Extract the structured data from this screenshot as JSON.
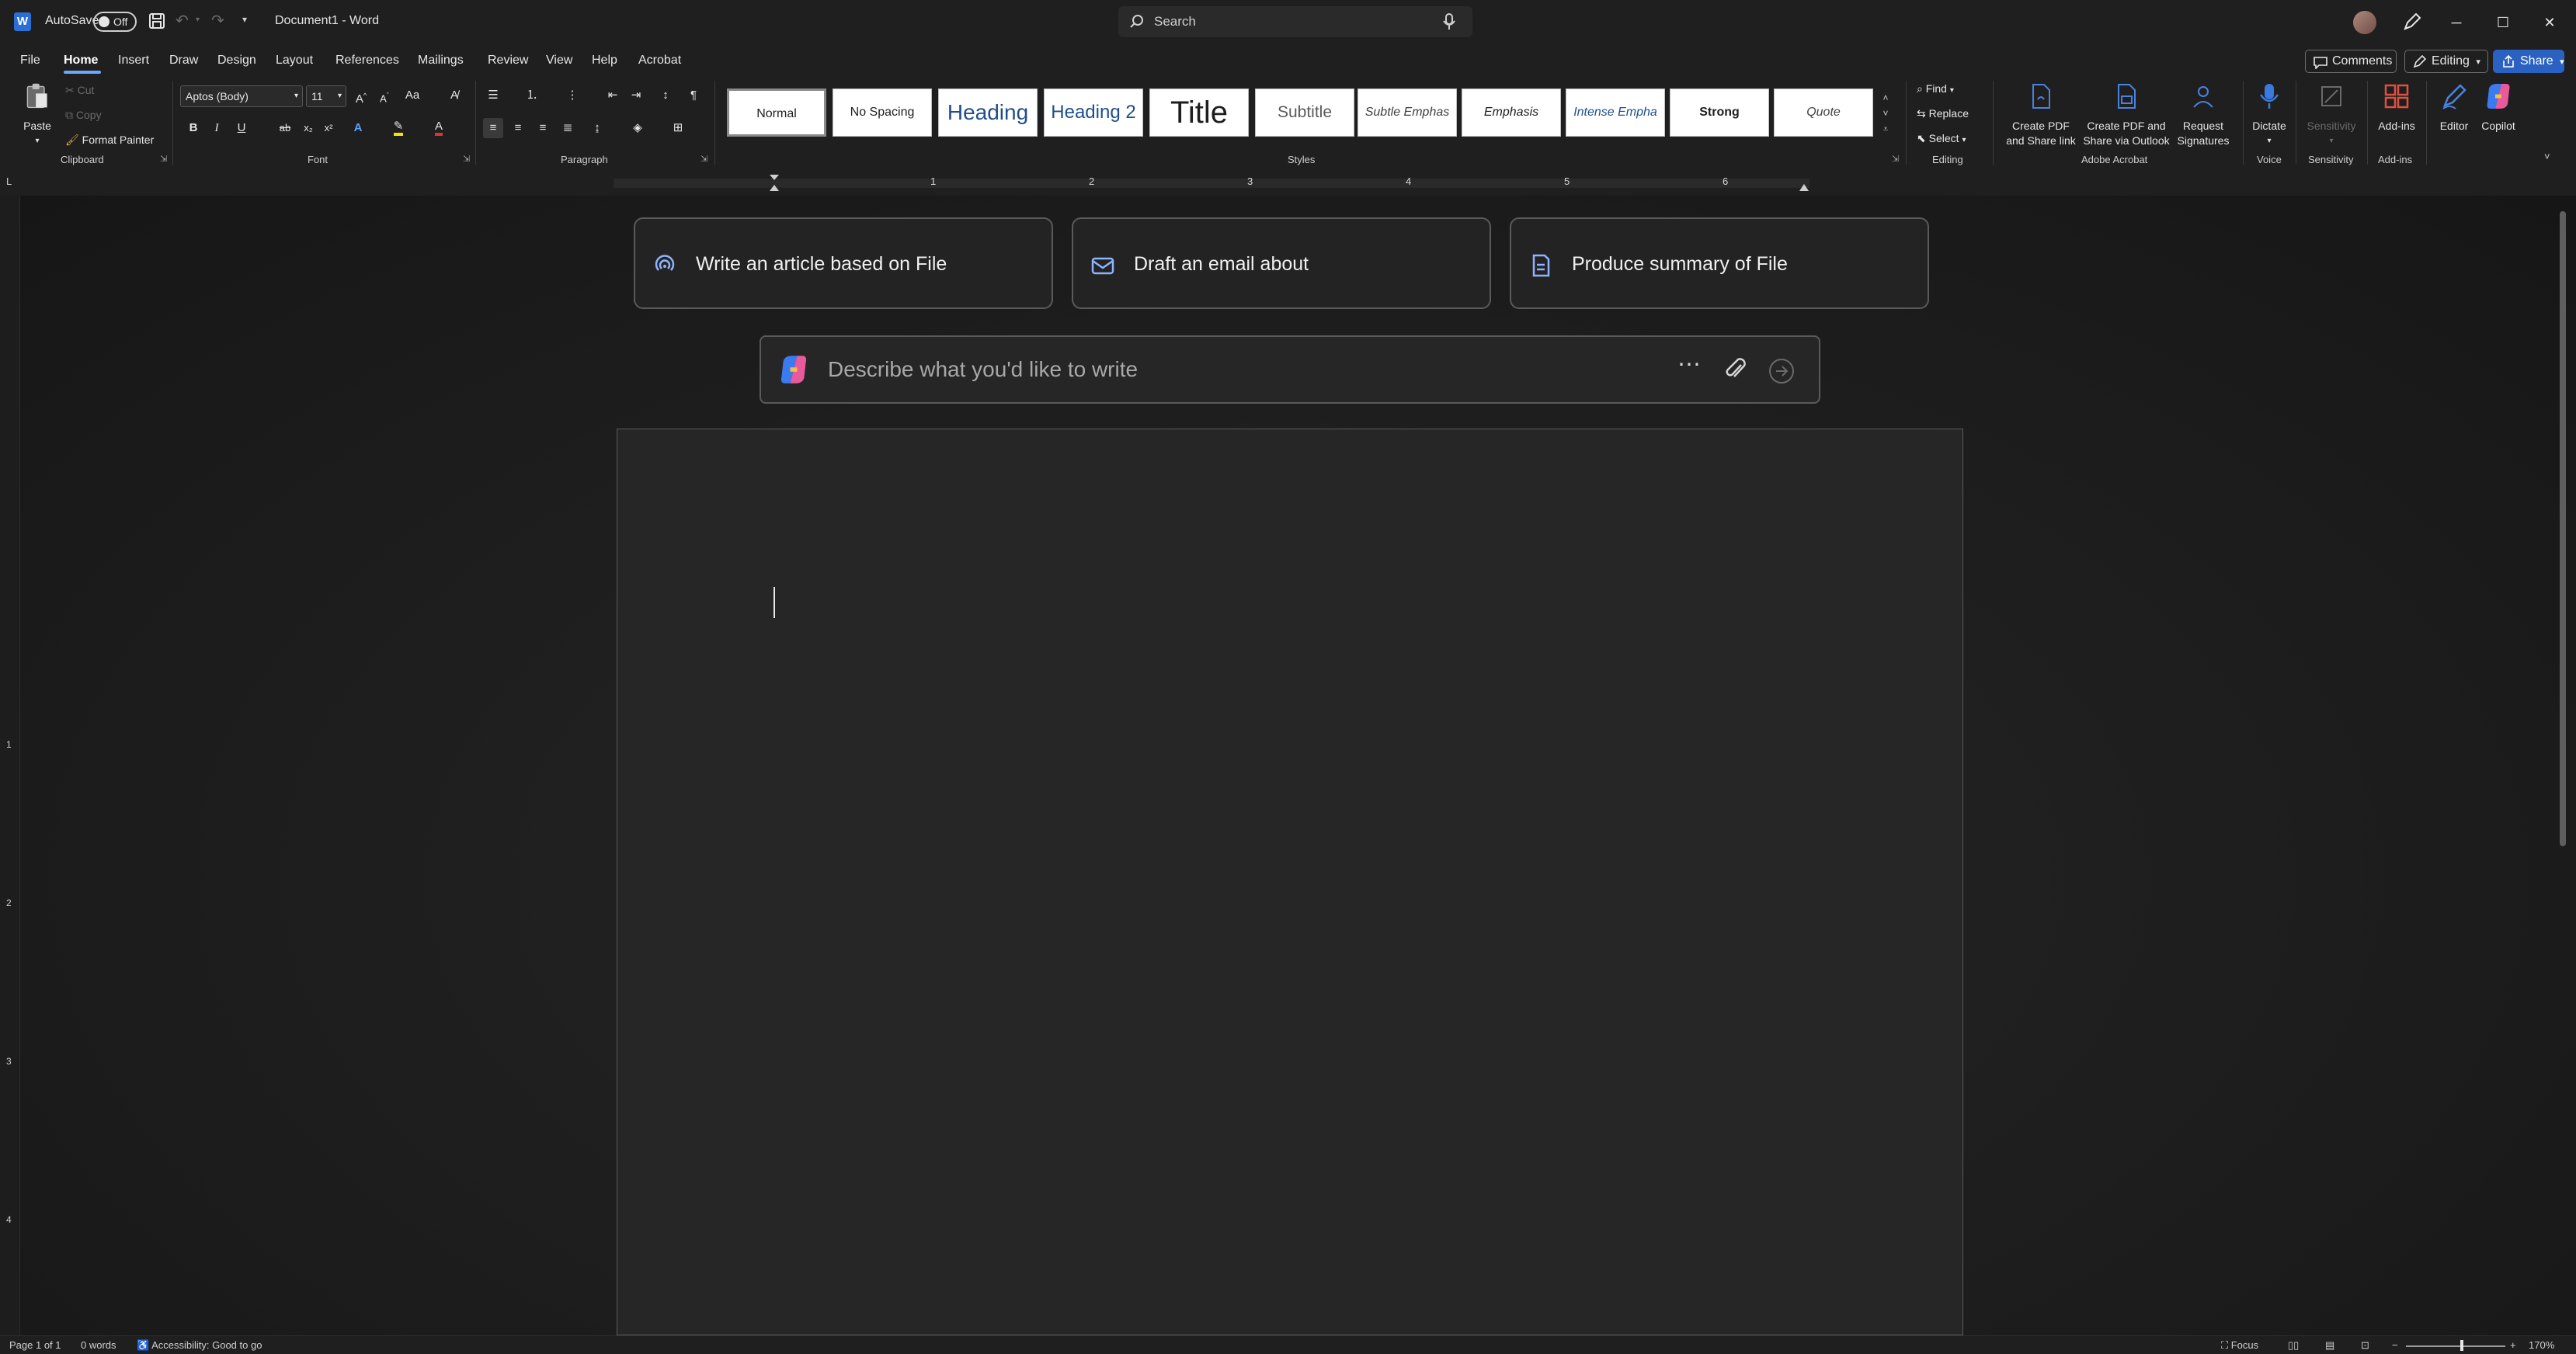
{
  "titlebar": {
    "autosave_label": "AutoSave",
    "autosave_state": "Off",
    "document_title": "Document1 - Word",
    "search_placeholder": "Search"
  },
  "tabs": [
    "File",
    "Home",
    "Insert",
    "Draw",
    "Design",
    "Layout",
    "References",
    "Mailings",
    "Review",
    "View",
    "Help",
    "Acrobat"
  ],
  "active_tab": "Home",
  "top_right": {
    "comments_label": "Comments",
    "editing_label": "Editing",
    "share_label": "Share"
  },
  "ribbon": {
    "clipboard": {
      "paste_label": "Paste",
      "cut_label": "Cut",
      "copy_label": "Copy",
      "format_painter_label": "Format Painter",
      "group_label": "Clipboard"
    },
    "font": {
      "font_name": "Aptos (Body)",
      "font_size": "11",
      "group_label": "Font"
    },
    "paragraph": {
      "group_label": "Paragraph"
    },
    "styles": {
      "items": [
        "Normal",
        "No Spacing",
        "Heading",
        "Heading 2",
        "Title",
        "Subtitle",
        "Subtle Emphas",
        "Emphasis",
        "Intense Empha",
        "Strong",
        "Quote"
      ],
      "group_label": "Styles"
    },
    "editing": {
      "find_label": "Find",
      "replace_label": "Replace",
      "select_label": "Select",
      "group_label": "Editing"
    },
    "acrobat": {
      "btn1_line1": "Create PDF",
      "btn1_line2": "and Share link",
      "btn2_line1": "Create PDF and",
      "btn2_line2": "Share via Outlook",
      "btn3_line1": "Request",
      "btn3_line2": "Signatures",
      "group_label": "Adobe Acrobat"
    },
    "voice": {
      "dictate_label": "Dictate",
      "group_label": "Voice"
    },
    "sensitivity": {
      "label": "Sensitivity",
      "group_label": "Sensitivity"
    },
    "addins": {
      "label": "Add-ins",
      "group_label": "Add-ins"
    },
    "editor_label": "Editor",
    "copilot_label": "Copilot"
  },
  "ruler": {
    "numbers": [
      "1",
      "2",
      "3",
      "4",
      "5",
      "6"
    ],
    "vertical_numbers": [
      "1",
      "2",
      "3",
      "4"
    ]
  },
  "copilot": {
    "suggestions": [
      {
        "text": "Write an article based on File",
        "icon": "article-icon"
      },
      {
        "text": "Draft an email about",
        "icon": "mail-icon"
      },
      {
        "text": "Produce summary of File",
        "icon": "document-icon"
      }
    ],
    "prompt_placeholder": "Describe what you'd like to write"
  },
  "statusbar": {
    "page": "Page 1 of 1",
    "words": "0 words",
    "accessibility": "Accessibility: Good to go",
    "focus": "Focus",
    "zoom": "170%"
  }
}
